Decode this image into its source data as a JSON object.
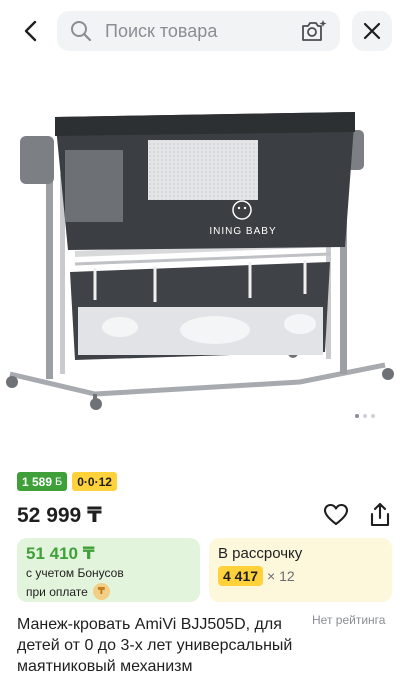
{
  "header": {
    "search_placeholder": "Поиск товара",
    "icons": [
      "back-arrow-icon",
      "search-icon",
      "camera-icon",
      "close-icon"
    ]
  },
  "gallery": {
    "image_text": "INING BABY",
    "dots_total": 3,
    "dot_active": 1
  },
  "badges": {
    "bonus_label": "1 589",
    "bonus_icon": "Б",
    "installment_label": "0·0·12"
  },
  "price": {
    "main": "52 999 ₸"
  },
  "bonus_card": {
    "amount": "51 410 ₸",
    "line1": "с учетом Бонусов",
    "line2": "при оплате"
  },
  "installment_card": {
    "title": "В рассрочку",
    "amount": "4 417",
    "multiplier": "× 12"
  },
  "product": {
    "title": "Манеж-кровать AmiVi BJJ505D, для детей от 0 до 3-х лет универсальный маятниковый механизм",
    "rating_text": "Нет рейтинга"
  },
  "colors": {
    "green": "#3fa03a",
    "yellow": "#ffd23c",
    "green_card_bg": "#e3f4dd",
    "yellow_card_bg": "#fdf8dc"
  }
}
